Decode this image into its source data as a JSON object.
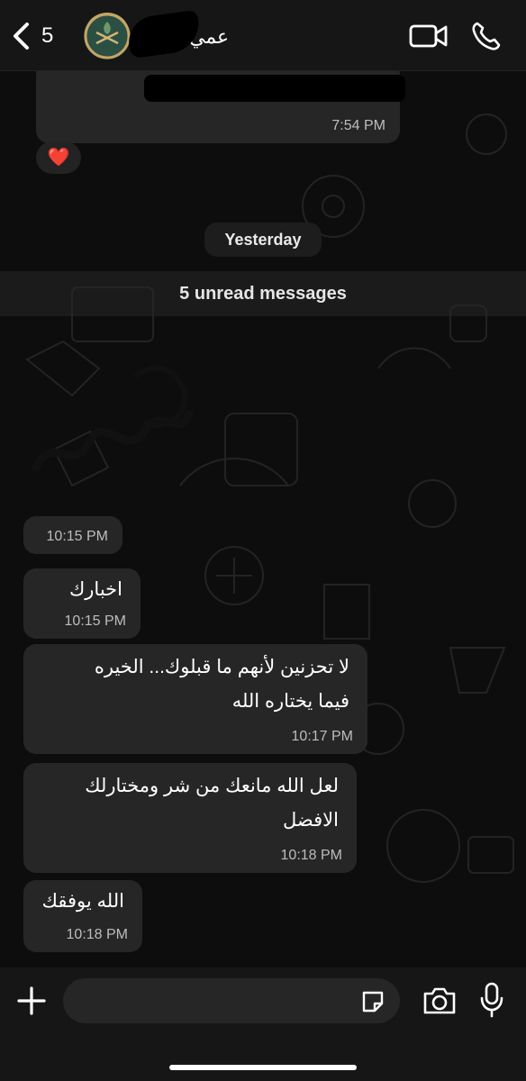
{
  "header": {
    "back_count": "5",
    "contact_name": "عمي"
  },
  "chat": {
    "previous_message_time": "7:54 PM",
    "reaction": "❤️",
    "date_separator": "Yesterday",
    "unread_banner": "5 unread messages",
    "messages": [
      {
        "lines": [],
        "time": "10:15 PM"
      },
      {
        "lines": [
          "اخبارك"
        ],
        "time": "10:15 PM"
      },
      {
        "lines": [
          "لا تحزنين لأنهم  ما قبلوك... الخيره",
          "فيما يختاره الله"
        ],
        "time": "10:17 PM"
      },
      {
        "lines": [
          "لعل الله مانعك من شر  ومختارلك",
          "الافضل"
        ],
        "time": "10:18 PM"
      },
      {
        "lines": [
          "الله يوفقك"
        ],
        "time": "10:18 PM"
      }
    ]
  },
  "colors": {
    "background": "#0b0b0b",
    "bubble": "#262626",
    "header": "#161616"
  },
  "icons": [
    "chevron-left-icon",
    "video-camera-icon",
    "phone-icon",
    "plus-icon",
    "sticker-icon",
    "camera-icon",
    "microphone-icon"
  ]
}
